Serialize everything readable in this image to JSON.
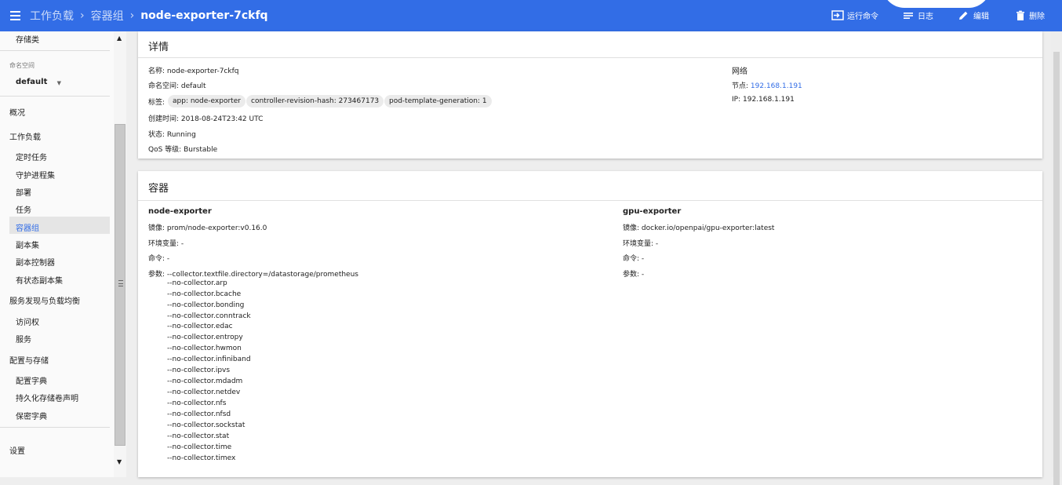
{
  "topbar": {
    "breadcrumbs": [
      "工作负载",
      "容器组"
    ],
    "current": "node-exporter-7ckfq",
    "actions": {
      "exec": "运行命令",
      "logs": "日志",
      "edit": "编辑",
      "delete": "删除"
    },
    "color": "#326de6"
  },
  "sidebar": {
    "storage_class": "存储类",
    "namespace_label": "命名空间",
    "namespace_value": "default",
    "overview": "概况",
    "workloads": "工作负载",
    "workload_items": [
      "定时任务",
      "守护进程集",
      "部署",
      "任务",
      "容器组",
      "副本集",
      "副本控制器",
      "有状态副本集"
    ],
    "discovery": "服务发现与负载均衡",
    "discovery_items": [
      "访问权",
      "服务"
    ],
    "config": "配置与存储",
    "config_items": [
      "配置字典",
      "持久化存储卷声明",
      "保密字典"
    ],
    "settings": "设置",
    "active_item": "容器组"
  },
  "details": {
    "title": "详情",
    "name_label": "名称:",
    "name": "node-exporter-7ckfq",
    "namespace_label": "命名空间:",
    "namespace": "default",
    "labels_label": "标签:",
    "labels": [
      "app: node-exporter",
      "controller-revision-hash: 273467173",
      "pod-template-generation: 1"
    ],
    "created_label": "创建时间:",
    "created": "2018-08-24T23:42 UTC",
    "status_label": "状态:",
    "status": "Running",
    "qos_label": "QoS 等级:",
    "qos": "Burstable",
    "network_title": "网络",
    "node_label": "节点:",
    "node": "192.168.1.191",
    "ip_label": "IP:",
    "ip": "192.168.1.191"
  },
  "containers": {
    "title": "容器",
    "image_label": "镜像:",
    "env_label": "环境变量:",
    "cmd_label": "命令:",
    "args_label": "参数:",
    "list": [
      {
        "name": "node-exporter",
        "image": "prom/node-exporter:v0.16.0",
        "env": "-",
        "command": "-",
        "args_first": "--collector.textfile.directory=/datastorage/prometheus",
        "args_rest": [
          "--no-collector.arp",
          "--no-collector.bcache",
          "--no-collector.bonding",
          "--no-collector.conntrack",
          "--no-collector.edac",
          "--no-collector.entropy",
          "--no-collector.hwmon",
          "--no-collector.infiniband",
          "--no-collector.ipvs",
          "--no-collector.mdadm",
          "--no-collector.netdev",
          "--no-collector.nfs",
          "--no-collector.nfsd",
          "--no-collector.sockstat",
          "--no-collector.stat",
          "--no-collector.time",
          "--no-collector.timex"
        ]
      },
      {
        "name": "gpu-exporter",
        "image": "docker.io/openpai/gpu-exporter:latest",
        "env": "-",
        "command": "-",
        "args": "-"
      }
    ]
  }
}
